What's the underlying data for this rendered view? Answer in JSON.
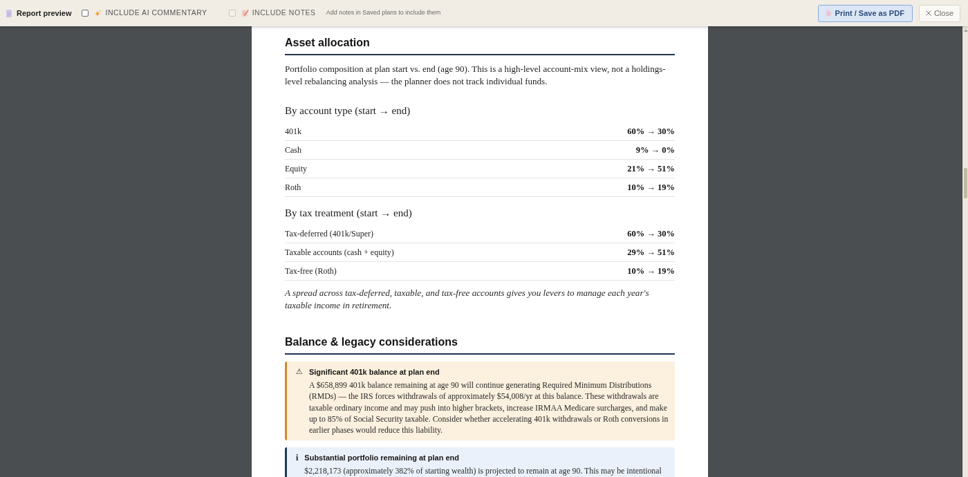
{
  "toolbar": {
    "title": "Report preview",
    "options": [
      {
        "kind": "ai",
        "label": "INCLUDE AI COMMENTARY",
        "checked": false,
        "disabled": false
      },
      {
        "kind": "notes",
        "label": "INCLUDE NOTES",
        "checked": false,
        "disabled": true,
        "hint": "Add notes in Saved plans to include them"
      }
    ],
    "buttons": [
      {
        "kind": "print",
        "label": "Print / Save as PDF"
      },
      {
        "kind": "close",
        "label": "Close"
      }
    ]
  },
  "sections": [
    {
      "heading": "Asset allocation",
      "blocks": [
        {
          "kind": "paragraph",
          "text": "Portfolio composition at plan start vs. end (age 90). This is a high-level account-mix view, not a holdings-level rebalancing analysis — the planner does not track individual funds."
        },
        {
          "kind": "subheading",
          "text": "By account type (start → end)"
        },
        {
          "kind": "table",
          "rows": [
            {
              "label": "401k",
              "value": "60% → 30%"
            },
            {
              "label": "Cash",
              "value": "9% → 0%"
            },
            {
              "label": "Equity",
              "value": "21% → 51%"
            },
            {
              "label": "Roth",
              "value": "10% → 19%"
            }
          ]
        },
        {
          "kind": "subheading",
          "text": "By tax treatment (start → end)"
        },
        {
          "kind": "table",
          "rows": [
            {
              "label": "Tax-deferred (401k/Super)",
              "value": "60% → 30%"
            },
            {
              "label": "Taxable accounts (cash + equity)",
              "value": "29% → 51%"
            },
            {
              "label": "Tax-free (Roth)",
              "value": "10% → 19%"
            }
          ]
        },
        {
          "kind": "note",
          "text": "A spread across tax-deferred, taxable, and tax-free accounts gives you levers to manage each year's taxable income in retirement."
        }
      ]
    },
    {
      "heading": "Balance & legacy considerations",
      "blocks": [
        {
          "kind": "warning",
          "icon": "⚠",
          "title": "Significant 401k balance at plan end",
          "text": "A $658,899 401k balance remaining at age 90 will continue generating Required Minimum Distributions (RMDs) — the IRS forces withdrawals of approximately $54,008/yr at this balance. These withdrawals are taxable ordinary income and may push into higher brackets, increase IRMAA Medicare surcharges, and make up to 85% of Social Security taxable. Consider whether accelerating 401k withdrawals or Roth conversions in earlier phases would reduce this liability."
        },
        {
          "kind": "info",
          "icon": "i",
          "title": "Substantial portfolio remaining at plan end",
          "text": "$2,218,173 (approximately 382% of starting wealth) is projected to remain at age 90. This may be intentional"
        }
      ]
    }
  ]
}
